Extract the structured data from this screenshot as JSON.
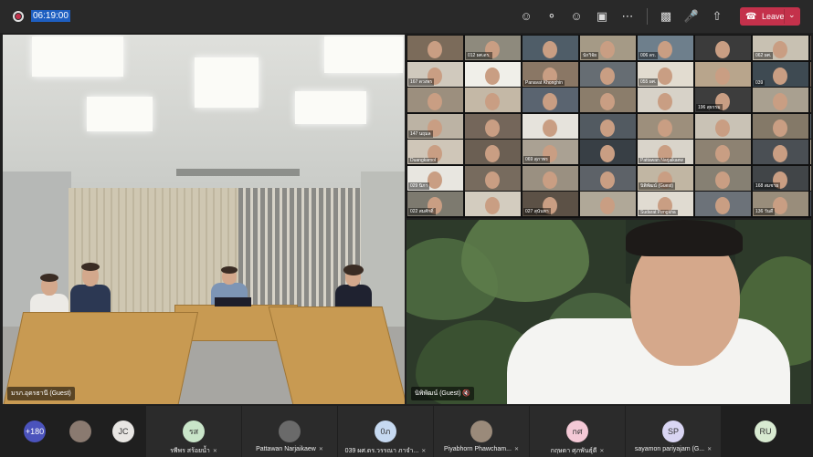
{
  "topbar": {
    "timer": "06:19:00",
    "leave_label": "Leave",
    "icons": [
      "participants-icon",
      "chat-icon",
      "reactions-icon",
      "share-screen-icon",
      "more-icon",
      "camera-off-icon",
      "mic-off-icon",
      "share-tray-icon"
    ]
  },
  "room": {
    "name": "มรภ.อุดรธานี (Guest)"
  },
  "gallery": {
    "labels": [
      "",
      "012 ผศ.ดร.",
      "",
      "นักวิจัย",
      "006 ดร.",
      "",
      "062 ผศ.",
      "",
      "167 ดวงพร",
      "",
      "Panavat Khonghin",
      "",
      "055 ผศ.",
      "",
      "039",
      "",
      "",
      "",
      "",
      "",
      "",
      "196 สุธรรม",
      "",
      "",
      "147 นฤมล",
      "",
      "",
      "",
      "",
      "",
      "",
      "",
      "Duangkamol",
      "",
      "069 สุภาพร",
      "",
      "Pattawan Narjaikaew",
      "",
      "",
      "",
      "029 นิภา",
      "",
      "",
      "",
      "นิพิพัฒน์ (Guest)",
      "",
      "168 สมชาย",
      "",
      "022 สมศักดิ์",
      "",
      "027 สุนันทา",
      "",
      "Sudarat Pengkha",
      "",
      "136 วันดี",
      "มรภ.สกลนคร"
    ],
    "colors": [
      "#7b6b5a",
      "#8e8a7d",
      "#4f5d68",
      "#a59a86",
      "#6e7f8c",
      "#3b3b3b",
      "#c8c1b2",
      "#5b5048",
      "#d0c9bd",
      "#f0efe9",
      "#8a7765",
      "#666d73",
      "#e2dcd0",
      "#b8a58c",
      "#3e4a52",
      "#7e6b5d",
      "#9c8f7e",
      "#c4b8a6",
      "#5a6470",
      "#8b7d6b",
      "#d7d2c8",
      "#3d3d3d",
      "#a9a090",
      "#6f6557",
      "#bcb3a4",
      "#74665a",
      "#e6e3dc",
      "#525a61",
      "#9d8f7c",
      "#c9c2b5",
      "#847968",
      "#5f6a70",
      "#cfc6b8",
      "#6b5f53",
      "#aaa193",
      "#383f45",
      "#d9d4ca",
      "#8d8272",
      "#4a4f54",
      "#b5aa98",
      "#e8e6e0",
      "#776b5e",
      "#9a9081",
      "#5d6268",
      "#c1b6a3",
      "#868073",
      "#414548",
      "#a89f90",
      "#7d7a6f",
      "#d3ccbf",
      "#5c5146",
      "#b0a898",
      "#e0dbd1",
      "#6c7279",
      "#998d7b",
      "#4e5860"
    ]
  },
  "speaker": {
    "name": "นิพิพัฒน์ (Guest)"
  },
  "participants": [
    {
      "initials": "+180",
      "name": "",
      "color": "#4b53bc"
    },
    {
      "initials": "",
      "name": "",
      "color": "#8a7a70"
    },
    {
      "initials": "JC",
      "name": "",
      "color": "#e8e6e3"
    },
    {
      "initials": "รส",
      "name": "รพีพร สร้อยน้ำ",
      "color": "#c9e5c9"
    },
    {
      "initials": "",
      "name": "Pattawan Narjaikaew",
      "color": "#6a6a6a"
    },
    {
      "initials": "0ภ",
      "name": "039 ผศ.ดร.วรรณา ภาจำ...",
      "color": "#c6d9f1"
    },
    {
      "initials": "",
      "name": "Piyabhorn Phawcham...",
      "color": "#9a8a7a"
    },
    {
      "initials": "กศ",
      "name": "กฤษดา ศุภพันธุ์ดี",
      "color": "#f4c9d6"
    },
    {
      "initials": "SP",
      "name": "sayamon pariyajam (G...",
      "color": "#d9d5f3"
    },
    {
      "initials": "RU",
      "name": "",
      "color": "#d8ead1"
    }
  ]
}
